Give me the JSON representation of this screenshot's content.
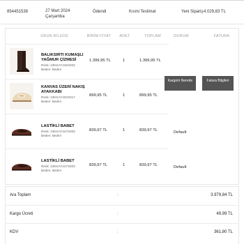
{
  "order": {
    "number": "854451538",
    "date_line1": "27 Mart 2024",
    "date_line2": "Çarşamba",
    "payment": "Ödendi",
    "delivery": "Kısmi Teslimat",
    "status": "Yeni Sipariş",
    "total": "4.029,83 TL"
  },
  "table": {
    "headers": {
      "product": "ÜRÜN BİLGİSİ",
      "unit_price": "BİRİM FİYAT",
      "qty": "ADET",
      "total": "TOPLAM",
      "status": "DURUM",
      "invoice": "FATURA"
    },
    "items": [
      {
        "name": "BALIKSIRTI KUMAŞLI YAĞMUR ÇİZMESİ",
        "color": "Renk: 23KKAY445X003",
        "size": "Beden: Beden",
        "unit_price": "1.399,95 TL",
        "qty": "1",
        "total": "1.399,95 TL",
        "status": ""
      },
      {
        "name": "KANVAS ÜZERİ NAKIŞ AYAKKABI",
        "color": "Renk: 23KKAY402X017",
        "size": "Beden: Beden",
        "unit_price": "899,95 TL",
        "qty": "1",
        "total": "899,95 TL",
        "status": ""
      },
      {
        "name": "LASTİKLİ BABET",
        "color": "Renk: 23KKAY447X003",
        "size": "Beden: Beden",
        "unit_price": "839,97 TL",
        "qty": "1",
        "total": "839,97 TL",
        "status": "Default"
      },
      {
        "name": "LASTİKLİ BABET",
        "color": "Renk: 23KKAY447X003",
        "size": "Beden: Beden",
        "unit_price": "839,97 TL",
        "qty": "1",
        "total": "839,97 TL",
        "status": "Default"
      }
    ],
    "cargo_button": "Kargom Nerede",
    "invoice_button": "Fatura Bilgileri"
  },
  "totals": {
    "subtotal_label": "Ara Toplam",
    "subtotal_value": "3.979,84 TL",
    "shipping_label": "Kargo Ücreti",
    "shipping_value": "49,99 TL",
    "tax_label": "KDV",
    "tax_value": "361,80 TL",
    "separator": ":"
  }
}
